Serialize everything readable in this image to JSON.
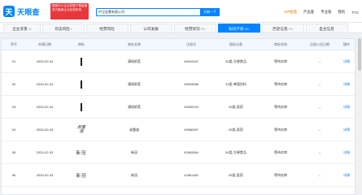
{
  "header": {
    "logo_glyph": "天",
    "logo_text": "天眼查",
    "ad_line1": "国家中小企业发展子基金旗下",
    "ad_line2": "官方备案企业征信机构",
    "search_value": "中汉金鼎有限公司",
    "search_button": "天眼一下",
    "vip_label": "VIP会员",
    "nav_product": "产品套",
    "nav_service": "专业版",
    "nav_phone": "我的",
    "nav_user": "TYC"
  },
  "tabs": [
    {
      "label": "企业背景",
      "count": "40"
    },
    {
      "label": "司法风险",
      "count": "1"
    },
    {
      "label": "经营风险",
      "count": ""
    },
    {
      "label": "公司发展",
      "count": ""
    },
    {
      "label": "经营状况",
      "count": "99+"
    },
    {
      "label": "知识产权",
      "count": "99+"
    },
    {
      "label": "历史信息",
      "count": "99+"
    },
    {
      "label": "自主信息",
      "count": ""
    }
  ],
  "table": {
    "headers": [
      "序号",
      "申请日期",
      "商标",
      "商标名称",
      "注册号",
      "国际分类",
      "商标状态",
      "注册公告日期",
      "操作"
    ],
    "rows": [
      {
        "no": "91",
        "date": "2020-02-04",
        "mark_style": "bar",
        "mark_text": "",
        "name": "满瑶帆茗",
        "reg_no": "43994167",
        "cls": "30类-方便食品",
        "status": "等待实审",
        "pub_date": "--",
        "action": "详情"
      },
      {
        "no": "92",
        "date": "2020-02-04",
        "mark_style": "bar",
        "mark_text": "",
        "name": "满瑶帆茗",
        "reg_no": "43993086",
        "cls": "32类-啤酒饮料",
        "status": "等待实审",
        "pub_date": "--",
        "action": "详情"
      },
      {
        "no": "93",
        "date": "2020-02-04",
        "mark_style": "bar",
        "mark_text": "",
        "name": "满瑶帆茗",
        "reg_no": "43995703",
        "cls": "05类-医药",
        "status": "等待实审",
        "pub_date": "--",
        "action": "详情"
      },
      {
        "no": "94",
        "date": "2020-02-03",
        "mark_style": "calli",
        "mark_text": "叔重道",
        "name": "叔重道",
        "reg_no": "43986397",
        "cls": "05类-医药",
        "status": "等待实审",
        "pub_date": "--",
        "action": "详情"
      },
      {
        "no": "95",
        "date": "2020-02-03",
        "mark_style": "word",
        "mark_text": "新冠",
        "name": "新冠",
        "reg_no": "43983384",
        "cls": "30类-方便食品",
        "status": "等待实审",
        "pub_date": "--",
        "action": "详情"
      },
      {
        "no": "96",
        "date": "2020-02-03",
        "mark_style": "word",
        "mark_text": "新冠",
        "name": "新冠",
        "reg_no": "43981180",
        "cls": "05类-医药",
        "status": "等待实审",
        "pub_date": "--",
        "action": "详情"
      }
    ]
  }
}
